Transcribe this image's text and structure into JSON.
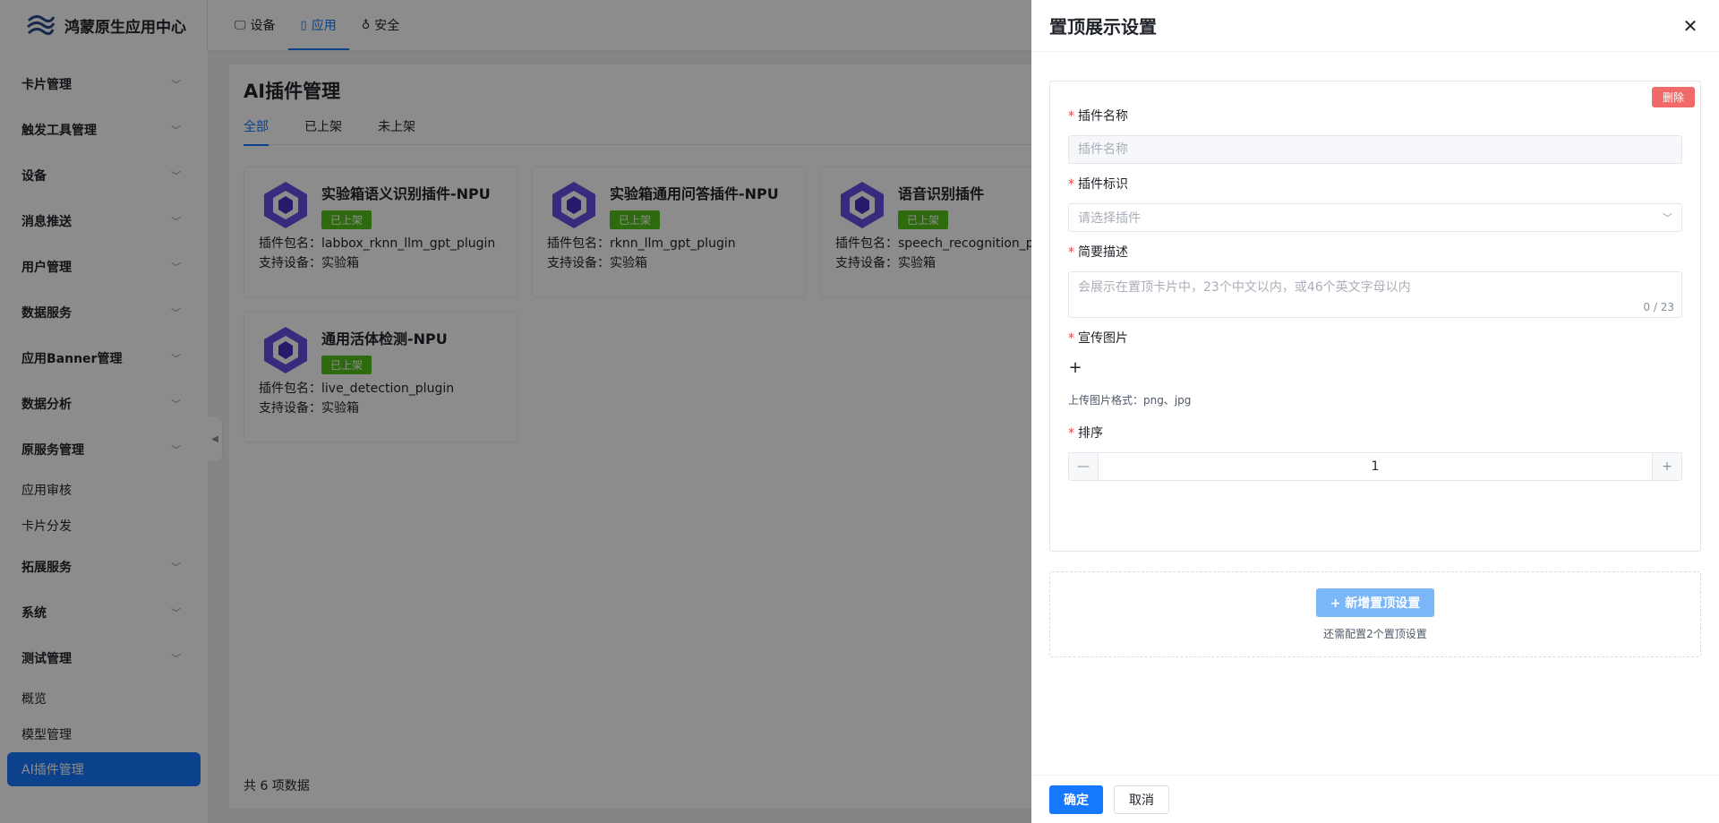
{
  "app": {
    "title": "鸿蒙原生应用中心"
  },
  "topnav": [
    {
      "label": "设备",
      "icon": "monitor-icon"
    },
    {
      "label": "应用",
      "icon": "tablet-icon",
      "active": true
    },
    {
      "label": "安全",
      "icon": "lock-icon"
    }
  ],
  "sidebar": {
    "items": [
      {
        "label": "卡片管理"
      },
      {
        "label": "触发工具管理"
      },
      {
        "label": "设备"
      },
      {
        "label": "消息推送"
      },
      {
        "label": "用户管理"
      },
      {
        "label": "数据服务"
      },
      {
        "label": "应用Banner管理"
      },
      {
        "label": "数据分析"
      },
      {
        "label": "原服务管理"
      },
      {
        "label": "应用审核"
      },
      {
        "label": "卡片分发"
      },
      {
        "label": "拓展服务"
      },
      {
        "label": "系统"
      },
      {
        "label": "测试管理"
      },
      {
        "label": "概览"
      },
      {
        "label": "模型管理"
      },
      {
        "label": "AI插件管理"
      }
    ]
  },
  "main": {
    "title": "AI插件管理",
    "tabs": [
      "全部",
      "已上架",
      "未上架"
    ],
    "cards": [
      {
        "title": "实验箱语义识别插件-NPU",
        "badge": "已上架",
        "package": "插件包名：labbox_rknn_llm_gpt_plugin",
        "device": "支持设备：实验箱"
      },
      {
        "title": "实验箱通用问答插件-NPU",
        "badge": "已上架",
        "package": "插件包名：rknn_llm_gpt_plugin",
        "device": "支持设备：实验箱"
      },
      {
        "title": "语音识别插件",
        "badge": "已上架",
        "package": "插件包名：speech_recognition_plu",
        "device": "支持设备：实验箱"
      },
      {
        "title": "通用活体检测-NPU",
        "badge": "已上架",
        "package": "插件包名：live_detection_plugin",
        "device": "支持设备：实验箱"
      }
    ],
    "total": "共 6 项数据"
  },
  "drawer": {
    "title": "置顶展示设置",
    "delete_label": "删除",
    "fields": {
      "name_label": "插件名称",
      "name_placeholder": "插件名称",
      "id_label": "插件标识",
      "id_placeholder": "请选择插件",
      "desc_label": "简要描述",
      "desc_placeholder": "会展示在置顶卡片中，23个中文以内，或46个英文字母以内",
      "desc_count": "0 / 23",
      "image_label": "宣传图片",
      "image_hint": "上传图片格式：png、jpg",
      "order_label": "排序",
      "order_value": "1"
    },
    "add_label": "+ 新增置顶设置",
    "add_hint": "还需配置2个置顶设置",
    "ok_label": "确定",
    "cancel_label": "取消"
  },
  "colors": {
    "primary": "#1677ff",
    "success": "#52c41a",
    "danger": "#f16a6a"
  }
}
